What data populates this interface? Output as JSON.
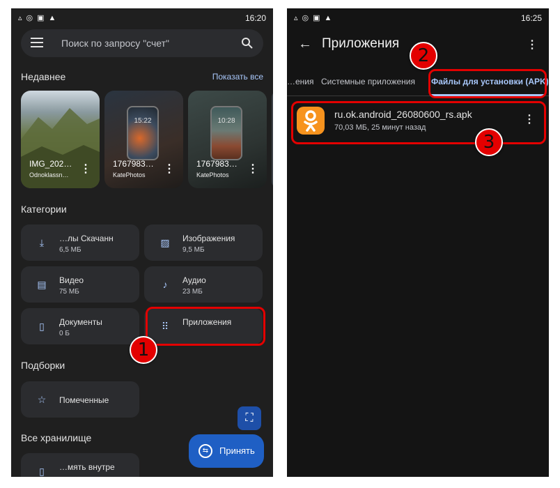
{
  "left": {
    "status": {
      "icons": [
        "A",
        "◎",
        "▣",
        "▲"
      ],
      "time": "16:20"
    },
    "search": {
      "placeholder": "Поиск по запросу \"счет\""
    },
    "recent": {
      "title": "Недавнее",
      "show_all": "Показать все",
      "items": [
        {
          "name": "IMG_202…",
          "source": "Odnoklassn…"
        },
        {
          "name": "1767983…",
          "source": "KatePhotos",
          "screen_time": "15:22"
        },
        {
          "name": "1767983…",
          "source": "KatePhotos",
          "screen_time": "10:28"
        }
      ]
    },
    "categories": {
      "title": "Категории",
      "items": [
        {
          "name": "…лы      Скачанн",
          "size": "6,5 МБ",
          "icon": "download-icon"
        },
        {
          "name": "Изображения",
          "size": "9,5 МБ",
          "icon": "image-icon"
        },
        {
          "name": "Видео",
          "size": "75 МБ",
          "icon": "video-icon"
        },
        {
          "name": "Аудио",
          "size": "23 МБ",
          "icon": "music-icon"
        },
        {
          "name": "Документы",
          "size": "0 Б",
          "icon": "document-icon"
        },
        {
          "name": "Приложения",
          "size": "",
          "icon": "apps-grid-icon"
        }
      ]
    },
    "collections": {
      "title": "Подборки",
      "starred": "Помеченные"
    },
    "storage": {
      "title": "Все хранилище",
      "item": "…мять      внутре"
    },
    "accept_button": "Принять",
    "annotation_1": "1"
  },
  "right": {
    "status": {
      "icons": [
        "A",
        "◎",
        "▣",
        "▲"
      ],
      "time": "16:25"
    },
    "title": "Приложения",
    "tabs": [
      "…ения",
      "Системные приложения",
      "Файлы для установки (APK)"
    ],
    "apk": {
      "name": "ru.ok.android_26080600_rs.apk",
      "meta": "70,03 МБ, 25 минут назад"
    },
    "annotation_2": "2",
    "annotation_3": "3"
  },
  "colors": {
    "accent": "#a8c7fa",
    "highlight_red": "#e30000",
    "ok_orange": "#f7931e",
    "fab_blue": "#1f5fc4"
  }
}
